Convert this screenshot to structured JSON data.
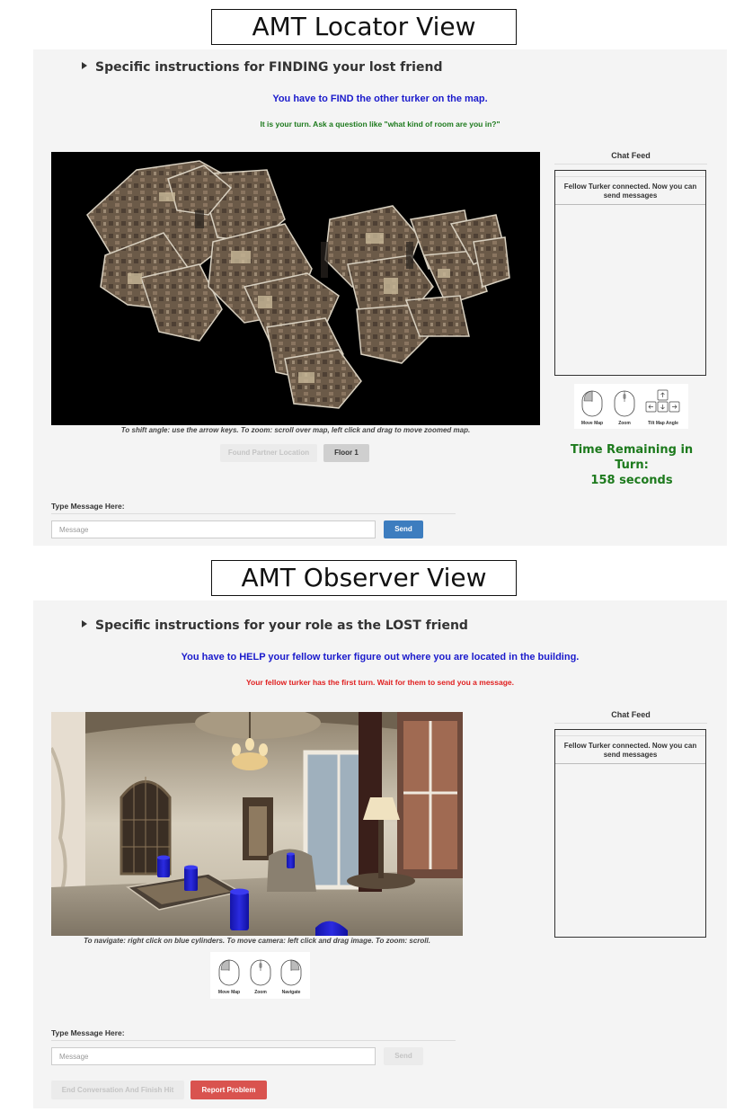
{
  "locator": {
    "view_title": "AMT Locator View",
    "instructions": "Specific instructions for FINDING your lost friend",
    "task": "You have to FIND the other turker on the map.",
    "turn_message": "It is your turn. Ask a question like \"what kind of room are you in?\"",
    "map_caption": "To shift angle: use the arrow keys. To zoom: scroll over map, left click and drag to move zoomed map.",
    "found_button": "Found Partner Location",
    "floor_button": "Floor 1",
    "chat_title": "Chat Feed",
    "chat_message": "Fellow Turker connected. Now you can send messages",
    "controls": [
      "Move Map",
      "Zoom",
      "Tilt Map Angle"
    ],
    "timer_line1": "Time Remaining in Turn:",
    "timer_line2": "158 seconds",
    "type_label": "Type Message Here:",
    "input_placeholder": "Message",
    "send_button": "Send"
  },
  "observer": {
    "view_title": "AMT Observer View",
    "instructions": "Specific instructions for your role as the LOST friend",
    "task": "You have to HELP your fellow turker figure out where you are located in the building.",
    "turn_message": "Your fellow turker has the first turn. Wait for them to send you a message.",
    "view_caption": "To navigate: right click on blue cylinders. To move camera: left click and drag image. To zoom: scroll.",
    "controls": [
      "Move Map",
      "Zoom",
      "Navigate"
    ],
    "chat_title": "Chat Feed",
    "chat_message": "Fellow Turker connected. Now you can send messages",
    "type_label": "Type Message Here:",
    "input_placeholder": "Message",
    "send_button": "Send",
    "end_button": "End Conversation And Finish Hit",
    "report_button": "Report Problem"
  },
  "colors": {
    "task_blue": "#1a1acc",
    "turn_green": "#1d7a1d",
    "turn_red": "#e02020",
    "send_blue": "#3d7dbf",
    "report_red": "#d9534f"
  }
}
